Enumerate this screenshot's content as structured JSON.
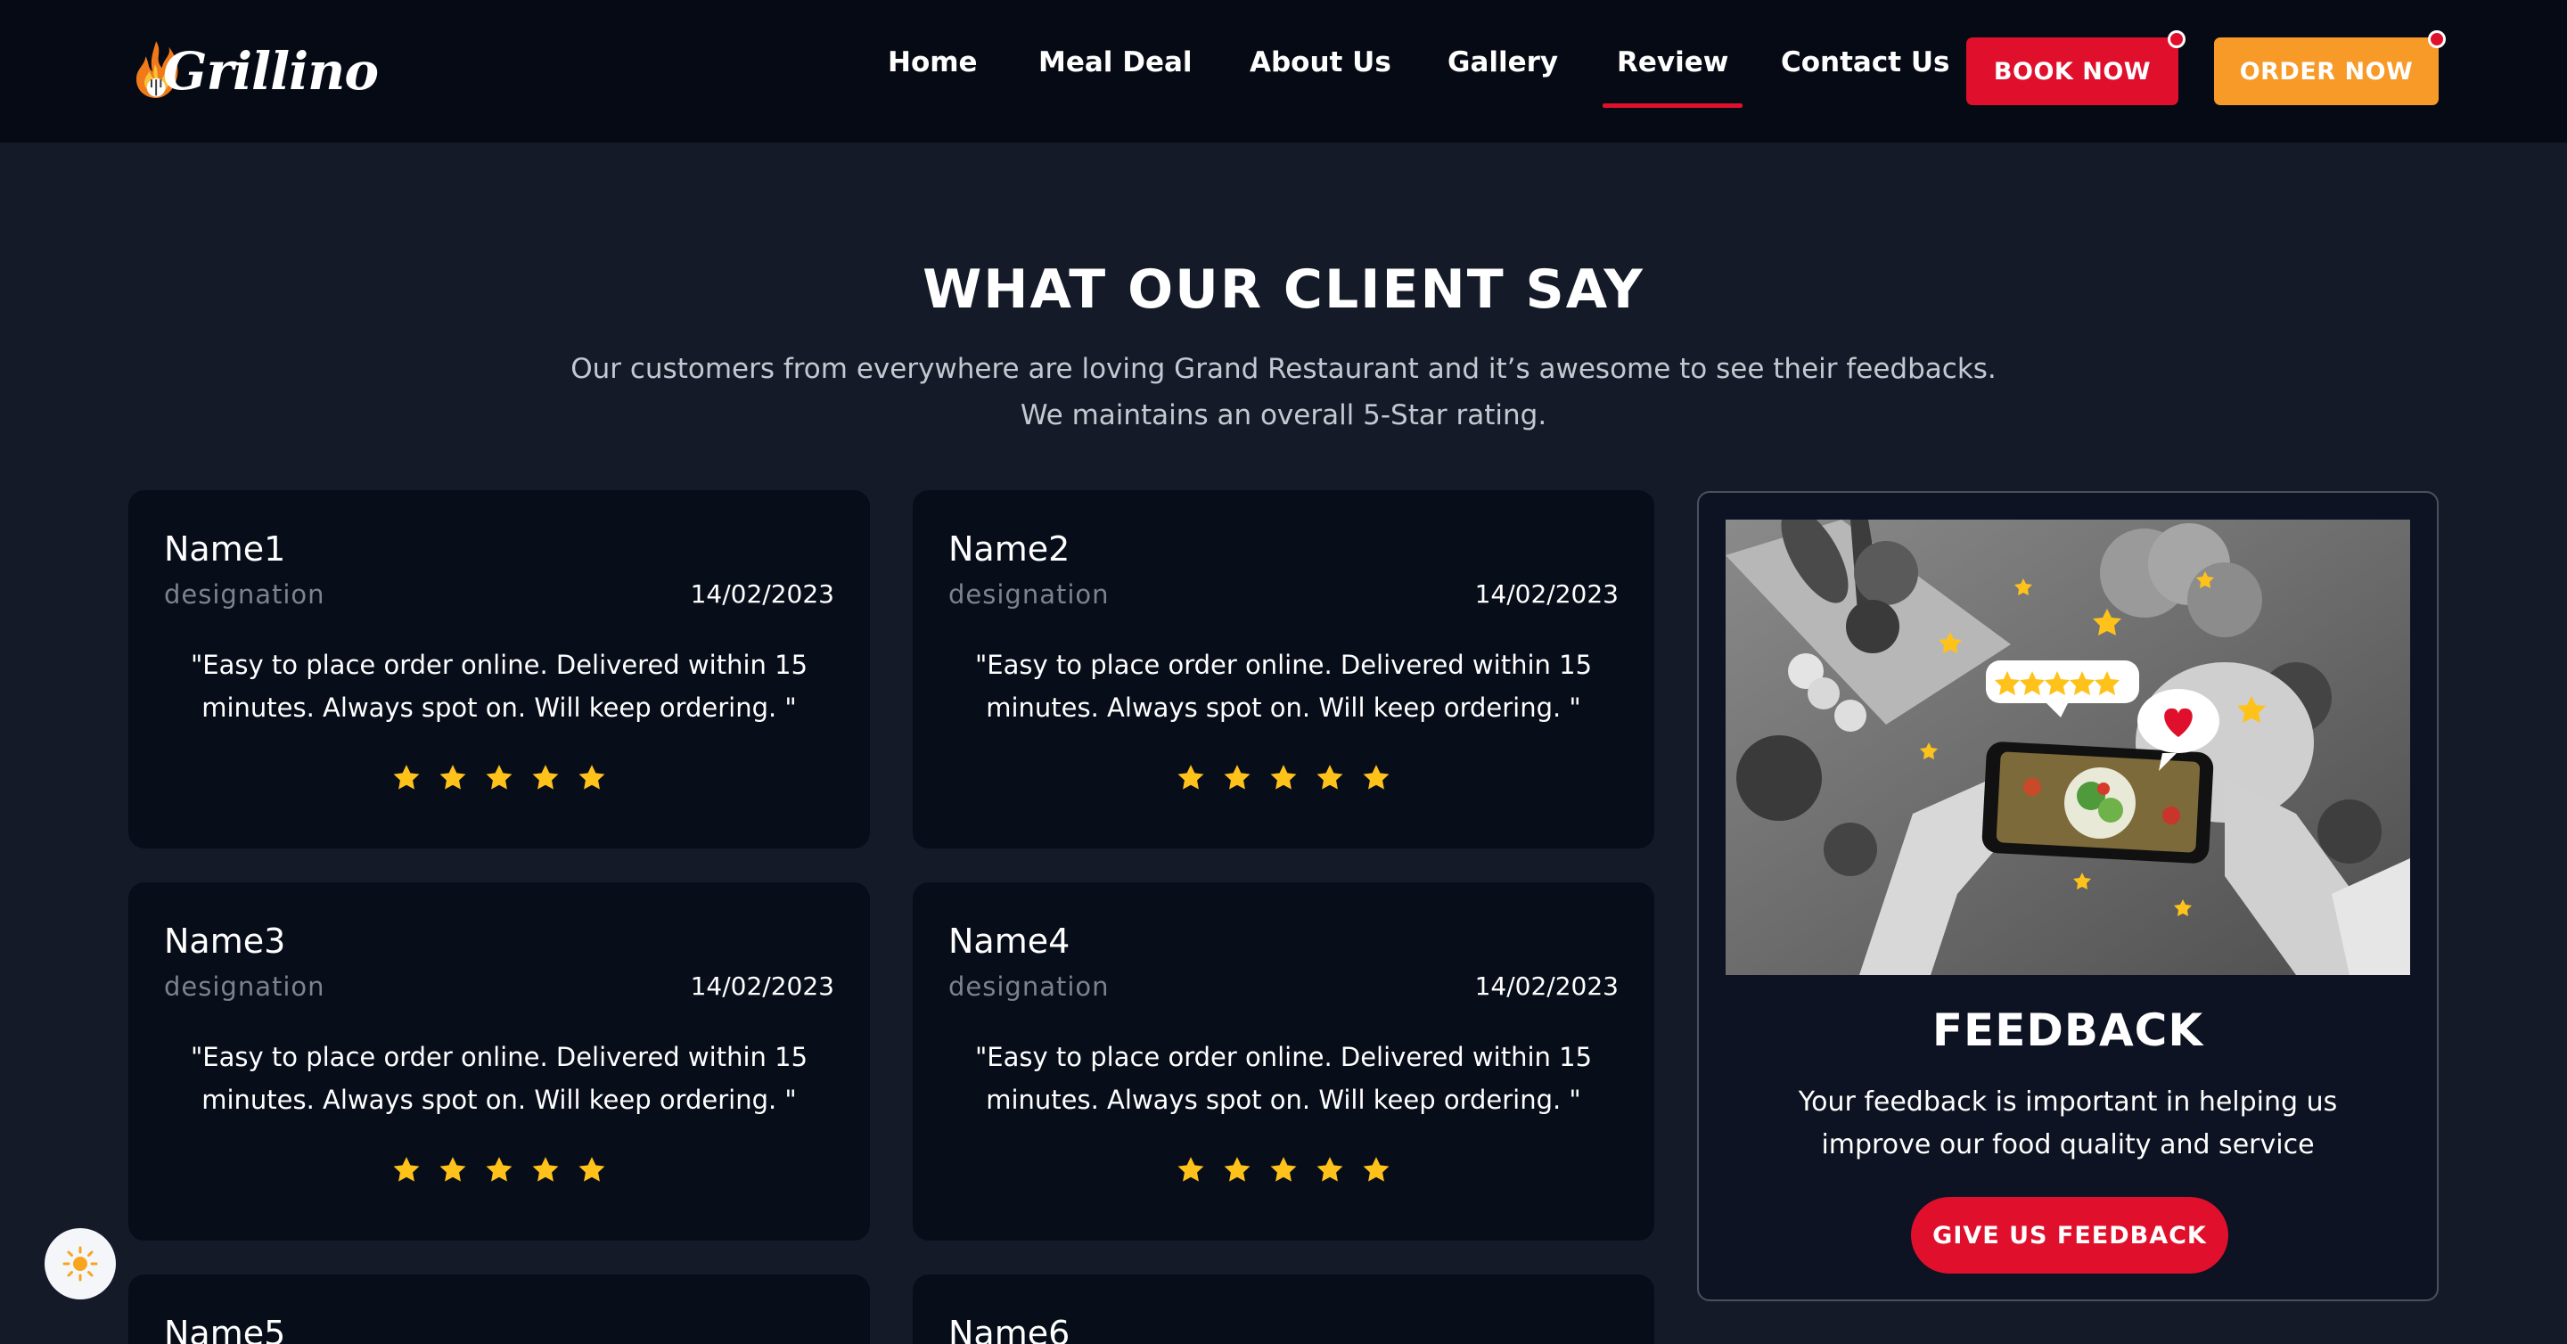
{
  "brand": {
    "name": "Grillino"
  },
  "nav": {
    "items": [
      {
        "label": "Home"
      },
      {
        "label": "Meal Deal"
      },
      {
        "label": "About Us"
      },
      {
        "label": "Gallery"
      },
      {
        "label": "Review",
        "active": true
      },
      {
        "label": "Contact Us"
      }
    ],
    "book_label": "BOOK NOW",
    "order_label": "ORDER NOW"
  },
  "section": {
    "title": "WHAT OUR CLIENT SAY",
    "subtitle_line1": "Our customers from everywhere are loving Grand Restaurant and it’s awesome to see their feedbacks.",
    "subtitle_line2": "We maintains an overall 5-Star rating."
  },
  "reviews": [
    {
      "name": "Name1",
      "designation": "designation",
      "date": "14/02/2023",
      "quote": "\"Easy to place order online. Delivered within 15 minutes. Always spot on. Will keep ordering. \"",
      "rating": 5
    },
    {
      "name": "Name2",
      "designation": "designation",
      "date": "14/02/2023",
      "quote": "\"Easy to place order online. Delivered within 15 minutes. Always spot on. Will keep ordering. \"",
      "rating": 5
    },
    {
      "name": "Name3",
      "designation": "designation",
      "date": "14/02/2023",
      "quote": "\"Easy to place order online. Delivered within 15 minutes. Always spot on. Will keep ordering. \"",
      "rating": 5
    },
    {
      "name": "Name4",
      "designation": "designation",
      "date": "14/02/2023",
      "quote": "\"Easy to place order online. Delivered within 15 minutes. Always spot on. Will keep ordering. \"",
      "rating": 5
    },
    {
      "name": "Name5"
    },
    {
      "name": "Name6"
    }
  ],
  "feedback": {
    "title": "FEEDBACK",
    "text": "Your feedback is important in helping us improve our food quality and service",
    "button_label": "GIVE US FEEDBACK"
  },
  "colors": {
    "accent_red": "#e0102c",
    "accent_orange": "#f79a27",
    "star_yellow": "#ffc21a",
    "background": "#141a28",
    "header": "#050a14",
    "card": "#080d1a"
  },
  "icons": {
    "logo": "flame-fork-logo-icon",
    "star": "star-icon",
    "theme_toggle": "sun-icon"
  }
}
